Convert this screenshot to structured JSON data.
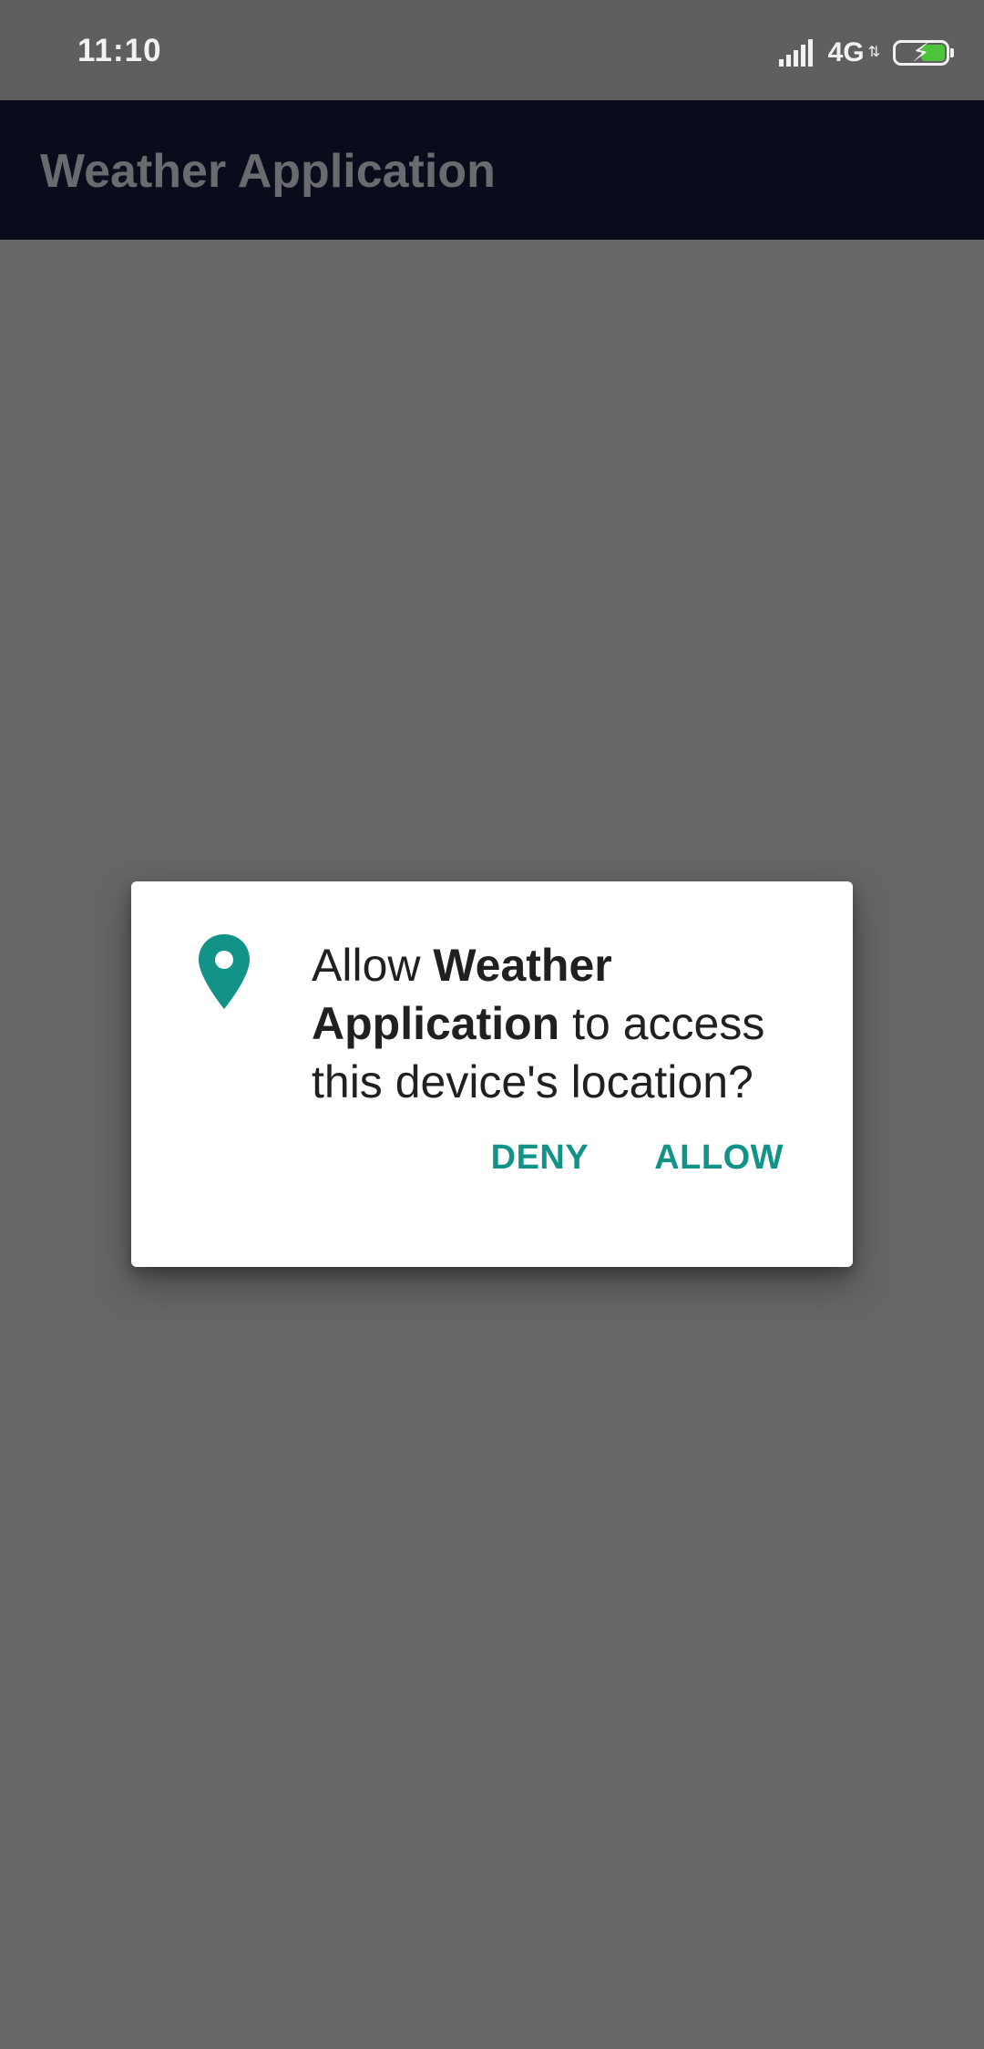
{
  "status_bar": {
    "time": "11:10",
    "network_type": "4G",
    "data_indicator": "⇅",
    "icons": [
      "signal-icon",
      "network-4g-icon",
      "battery-charging-icon"
    ],
    "battery_color": "#4cc33a"
  },
  "app_bar": {
    "title": "Weather Application",
    "background": "#080c1b"
  },
  "dialog": {
    "icon": "location-pin-icon",
    "icon_color": "#119487",
    "message_prefix": "Allow ",
    "app_name": "Weather Application",
    "message_suffix": " to access this device's location?",
    "deny_label": "DENY",
    "allow_label": "ALLOW",
    "accent_color": "#119487"
  },
  "colors": {
    "scrim": "#666666",
    "dialog_background": "#ffffff",
    "text_primary": "#202020"
  }
}
